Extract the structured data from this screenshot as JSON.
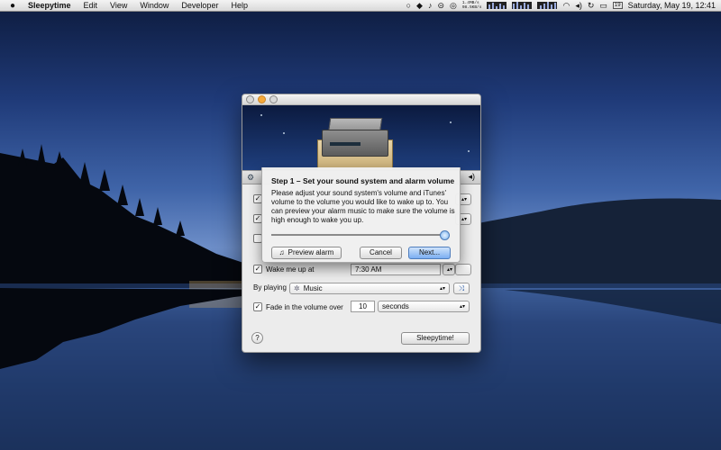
{
  "menubar": {
    "app_name": "Sleepytime",
    "menus": [
      "Edit",
      "View",
      "Window",
      "Developer",
      "Help"
    ],
    "net_up": "1.4MB/s",
    "net_down": "98.5KB/s",
    "datetime": "Saturday, May 19, 12:41",
    "calendar_day": "19"
  },
  "sheet": {
    "title": "Step 1 – Set your sound system and alarm volume",
    "body": "Please adjust your sound system's volume and iTunes' volume to the volume you would like to wake up to. You can preview your alarm music to make sure the volume is high enough to wake you up.",
    "volume_fraction": 1.0,
    "preview_label": "Preview alarm",
    "cancel_label": "Cancel",
    "next_label": "Next..."
  },
  "main": {
    "wake_label": "Wake me up at",
    "wake_time": "7:30 AM",
    "by_playing_label": "By playing",
    "playlist_value": "Music",
    "fade_label": "Fade in the volume over",
    "fade_amount": "10",
    "fade_unit": "seconds",
    "sleepytime_button": "Sleepytime!",
    "help_label": "?"
  }
}
